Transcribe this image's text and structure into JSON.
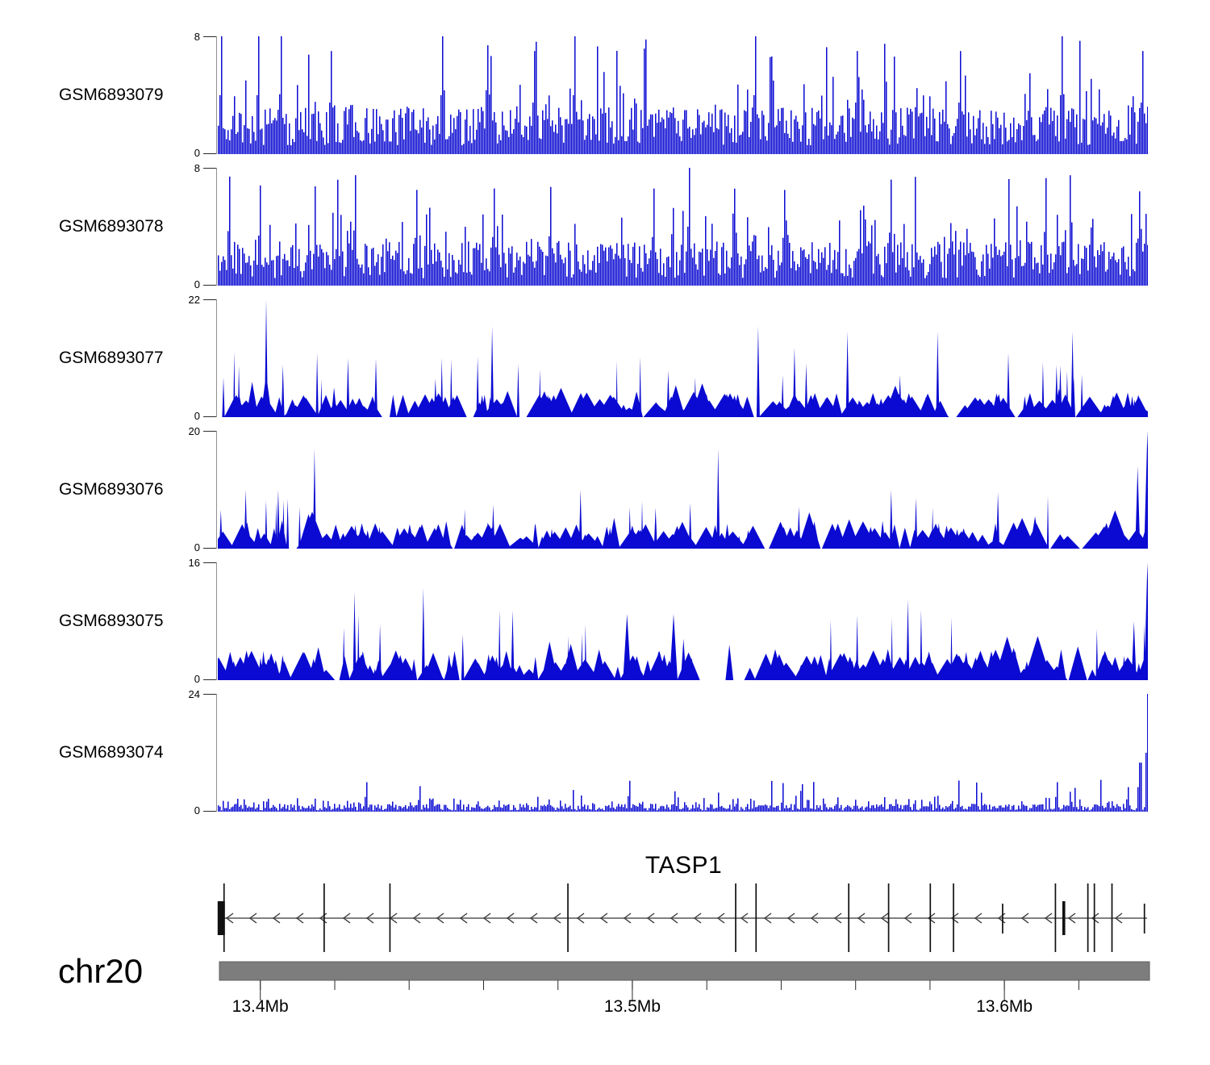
{
  "colors": {
    "track_fill": "#0a0ad2",
    "axis_line": "#8f8f8f",
    "tick_line": "#2a2a2a",
    "text": "#000000",
    "ideogram_fill": "#7d7d7d",
    "ideogram_border": "#5f5f5f",
    "gene_line": "#808080",
    "exon_color": "#111111",
    "arrow_color": "#3a3a3a"
  },
  "chart_data": {
    "type": "area",
    "description": "Genome browser coverage tracks over the TASP1 locus on chr20",
    "x_axis": {
      "chromosome": "chr20",
      "unit": "Mb",
      "start_mb": 13.389,
      "end_mb": 13.639,
      "labeled_ticks_mb": [
        13.4,
        13.5,
        13.6
      ],
      "tick_labels": [
        "13.4Mb",
        "13.5Mb",
        "13.6Mb"
      ],
      "minor_tick_start_mb": 13.4,
      "minor_tick_step_mb": 0.02,
      "minor_tick_count": 12
    },
    "tracks": [
      {
        "label": "GSM6893079",
        "ymax": 8,
        "ymax_label": "8",
        "ymin_label": "0",
        "style": "dense",
        "seed": 11,
        "base": [
          0.6,
          3.2
        ],
        "mid": {
          "p": 0.13,
          "add": [
            1.2,
            3.2
          ]
        },
        "top": {
          "p": 0.012
        },
        "notable_peaks": [
          {
            "x": 0.004,
            "v": 8
          },
          {
            "x": 0.043,
            "v": 8
          },
          {
            "x": 0.067,
            "v": 8
          },
          {
            "x": 0.122,
            "v": 7
          },
          {
            "x": 0.241,
            "v": 8
          },
          {
            "x": 0.341,
            "v": 7
          },
          {
            "x": 0.383,
            "v": 8
          },
          {
            "x": 0.578,
            "v": 8
          },
          {
            "x": 0.687,
            "v": 7
          },
          {
            "x": 0.798,
            "v": 7
          },
          {
            "x": 0.908,
            "v": 8
          },
          {
            "x": 0.994,
            "v": 7
          }
        ]
      },
      {
        "label": "GSM6893078",
        "ymax": 8,
        "ymax_label": "8",
        "ymin_label": "0",
        "style": "dense",
        "seed": 22,
        "base": [
          0.5,
          3.0
        ],
        "mid": {
          "p": 0.12,
          "add": [
            1.2,
            3.0
          ]
        },
        "top": {
          "p": 0.008
        },
        "notable_peaks": [
          {
            "x": 0.013,
            "v": 7.4
          },
          {
            "x": 0.045,
            "v": 6.8
          },
          {
            "x": 0.147,
            "v": 7.5
          },
          {
            "x": 0.213,
            "v": 6.5
          },
          {
            "x": 0.297,
            "v": 6.6
          },
          {
            "x": 0.358,
            "v": 6.7
          },
          {
            "x": 0.468,
            "v": 6.6
          },
          {
            "x": 0.507,
            "v": 8
          },
          {
            "x": 0.61,
            "v": 6.5
          },
          {
            "x": 0.724,
            "v": 7.2
          },
          {
            "x": 0.891,
            "v": 7.3
          },
          {
            "x": 0.991,
            "v": 6.4
          }
        ]
      },
      {
        "label": "GSM6893077",
        "ymax": 22,
        "ymax_label": "22",
        "ymin_label": "0",
        "style": "peaks",
        "seed": 33,
        "events": 185,
        "base": [
          1.6,
          4.6
        ],
        "spikes": {
          "count": 26,
          "h": [
            7,
            13
          ]
        },
        "notable_peaks": [
          {
            "x": 0.052,
            "v": 22,
            "w": 2
          },
          {
            "x": 0.052,
            "v": 8,
            "w": 7
          },
          {
            "x": 0.14,
            "v": 11,
            "w": 2
          },
          {
            "x": 0.17,
            "v": 11,
            "w": 2
          },
          {
            "x": 0.295,
            "v": 17,
            "w": 2
          },
          {
            "x": 0.581,
            "v": 17,
            "w": 2
          },
          {
            "x": 0.62,
            "v": 13,
            "w": 2
          },
          {
            "x": 0.677,
            "v": 16,
            "w": 2
          },
          {
            "x": 0.774,
            "v": 16,
            "w": 2
          },
          {
            "x": 0.85,
            "v": 12,
            "w": 2
          },
          {
            "x": 0.919,
            "v": 16,
            "w": 2
          }
        ]
      },
      {
        "label": "GSM6893076",
        "ymax": 20,
        "ymax_label": "20",
        "ymin_label": "0",
        "style": "peaks",
        "seed": 44,
        "events": 175,
        "base": [
          1.6,
          4.6
        ],
        "spikes": {
          "count": 18,
          "h": [
            6,
            10
          ]
        },
        "notable_peaks": [
          {
            "x": 0.03,
            "v": 10,
            "w": 2
          },
          {
            "x": 0.065,
            "v": 10,
            "w": 2
          },
          {
            "x": 0.104,
            "v": 17,
            "w": 2
          },
          {
            "x": 0.39,
            "v": 10,
            "w": 2
          },
          {
            "x": 0.538,
            "v": 17,
            "w": 2
          },
          {
            "x": 0.724,
            "v": 10,
            "w": 2
          },
          {
            "x": 0.989,
            "v": 14,
            "w": 3
          },
          {
            "x": 0.9995,
            "v": 20,
            "w": 4
          }
        ]
      },
      {
        "label": "GSM6893075",
        "ymax": 16,
        "ymax_label": "16",
        "ymin_label": "0",
        "style": "peaks",
        "seed": 55,
        "events": 170,
        "base": [
          1.3,
          4.2
        ],
        "spikes": {
          "count": 16,
          "h": [
            6,
            10
          ]
        },
        "notable_peaks": [
          {
            "x": 0.147,
            "v": 12,
            "w": 2
          },
          {
            "x": 0.221,
            "v": 12.5,
            "w": 2
          },
          {
            "x": 0.44,
            "v": 9,
            "w": 5
          },
          {
            "x": 0.49,
            "v": 9,
            "w": 5
          },
          {
            "x": 0.742,
            "v": 11,
            "w": 2
          },
          {
            "x": 0.985,
            "v": 8,
            "w": 3
          },
          {
            "x": 0.9995,
            "v": 16,
            "w": 4
          }
        ]
      },
      {
        "label": "GSM6893074",
        "ymax": 24,
        "ymax_label": "24",
        "ymin_label": "0",
        "style": "low",
        "seed": 66,
        "base": [
          0.25,
          1.6
        ],
        "mid": {
          "p": 0.16,
          "add": [
            0.5,
            2.0
          ]
        },
        "rare": {
          "p": 0.02,
          "range": [
            3,
            6.5
          ]
        },
        "notable_peaks": [
          {
            "x": 0.16,
            "v": 6
          },
          {
            "x": 0.442,
            "v": 6.3
          },
          {
            "x": 0.629,
            "v": 5.6
          },
          {
            "x": 0.902,
            "v": 6
          },
          {
            "x": 0.98,
            "v": 5
          },
          {
            "x": 0.992,
            "v": 10,
            "w": 3
          },
          {
            "x": 0.9995,
            "v": 24,
            "w": 5
          }
        ]
      }
    ],
    "gene_track": {
      "name": "TASP1",
      "strand": "-",
      "arrow_direction": "left",
      "arrow_spacing_px": 29,
      "exons": [
        {
          "pos": 0.002,
          "type": "box"
        },
        {
          "pos": 0.005,
          "type": "line",
          "h": "tall"
        },
        {
          "pos": 0.113,
          "type": "line",
          "h": "tall"
        },
        {
          "pos": 0.184,
          "type": "line",
          "h": "tall"
        },
        {
          "pos": 0.376,
          "type": "line",
          "h": "tall"
        },
        {
          "pos": 0.557,
          "type": "line",
          "h": "tall"
        },
        {
          "pos": 0.579,
          "type": "line",
          "h": "tall"
        },
        {
          "pos": 0.679,
          "type": "line",
          "h": "tall"
        },
        {
          "pos": 0.722,
          "type": "line",
          "h": "tall"
        },
        {
          "pos": 0.767,
          "type": "line",
          "h": "tall"
        },
        {
          "pos": 0.792,
          "type": "line",
          "h": "tall"
        },
        {
          "pos": 0.845,
          "type": "line",
          "h": "med"
        },
        {
          "pos": 0.902,
          "type": "line",
          "h": "tall"
        },
        {
          "pos": 0.911,
          "type": "bold",
          "h": "med"
        },
        {
          "pos": 0.937,
          "type": "line",
          "h": "tall"
        },
        {
          "pos": 0.944,
          "type": "line",
          "h": "tall"
        },
        {
          "pos": 0.963,
          "type": "line",
          "h": "tall"
        },
        {
          "pos": 0.998,
          "type": "line",
          "h": "med"
        }
      ]
    }
  }
}
